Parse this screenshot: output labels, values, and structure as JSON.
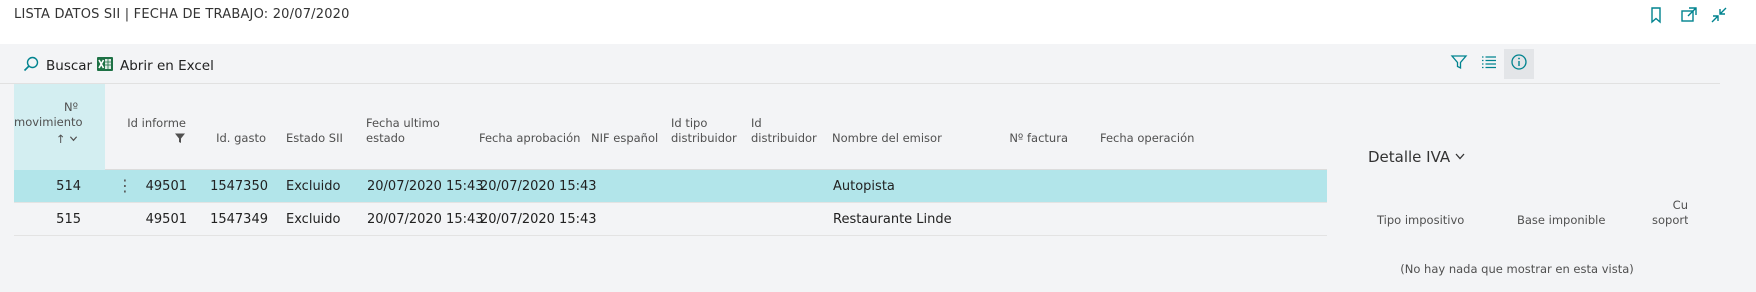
{
  "page_title": "LISTA DATOS SII | FECHA DE TRABAJO: 20/07/2020",
  "title_icons": [
    "bookmark-icon",
    "open-new-window-icon",
    "collapse-icon"
  ],
  "actions": {
    "search_label": "Buscar",
    "excel_label": "Abrir en Excel",
    "right_icons": [
      "filter-icon",
      "list-view-icon",
      "info-icon"
    ]
  },
  "table": {
    "headers": {
      "movimiento_line1": "Nº",
      "movimiento_line2": "movimiento",
      "movimiento_sort": "↑",
      "id_informe": "Id informe",
      "id_gasto": "Id. gasto",
      "estado": "Estado SII",
      "fecha_ultimo_line1": "Fecha ultimo",
      "fecha_ultimo_line2": "estado",
      "fecha_aprobacion": "Fecha aprobación",
      "nif": "NIF español",
      "id_tipo_line1": "Id tipo",
      "id_tipo_line2": "distribuidor",
      "id_dist_line1": "Id",
      "id_dist_line2": "distribuidor",
      "emisor": "Nombre del emisor",
      "factura": "Nº factura",
      "fecha_op": "Fecha operación"
    },
    "rows": [
      {
        "movimiento": "514",
        "id_informe": "49501",
        "id_gasto": "1547350",
        "estado": "Excluido",
        "fecha_ultimo": "20/07/2020 15:43",
        "fecha_aprobacion": "20/07/2020 15:43",
        "emisor": "Autopista"
      },
      {
        "movimiento": "515",
        "id_informe": "49501",
        "id_gasto": "1547349",
        "estado": "Excluido",
        "fecha_ultimo": "20/07/2020 15:43",
        "fecha_aprobacion": "20/07/2020 15:43",
        "emisor": "Restaurante Linde"
      }
    ],
    "row_menu": "⋮"
  },
  "factbox": {
    "title": "Detalle IVA",
    "col_tipo": "Tipo impositivo",
    "col_base": "Base imponible",
    "col_cuota_line1": "Cu",
    "col_cuota_line2": "soport",
    "empty_text": "(No hay nada que mostrar en esta vista)"
  },
  "colors": {
    "accent": "#00838f",
    "selected_row": "#b2e5ea",
    "sorted_header": "#d3eef1",
    "page_bg": "#f3f4f6",
    "excel_green": "#1e7145"
  }
}
